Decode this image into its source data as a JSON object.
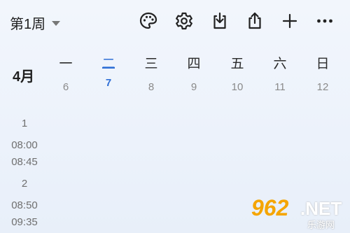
{
  "toolbar": {
    "week_label": "第1周",
    "icons": [
      "palette-icon",
      "gear-icon",
      "download-icon",
      "share-icon",
      "plus-icon",
      "more-icon"
    ]
  },
  "header": {
    "month": "4月",
    "days": [
      {
        "name": "一",
        "date": "6"
      },
      {
        "name": "二",
        "date": "7",
        "today": true
      },
      {
        "name": "三",
        "date": "8"
      },
      {
        "name": "四",
        "date": "9"
      },
      {
        "name": "五",
        "date": "10"
      },
      {
        "name": "六",
        "date": "11"
      },
      {
        "name": "日",
        "date": "12"
      }
    ]
  },
  "periods": [
    {
      "num": "1",
      "start": "08:00",
      "end": "08:45"
    },
    {
      "num": "2",
      "start": "08:50",
      "end": "09:35"
    }
  ],
  "watermark": {
    "numbers": "962",
    "net": ".NET",
    "site": "乐游网"
  },
  "colors": {
    "accent": "#2f6fd6",
    "muted": "#8a8a8a",
    "watermark": "#f5a500"
  }
}
